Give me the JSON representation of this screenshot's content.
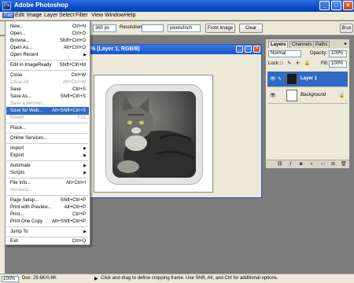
{
  "window": {
    "title": "Adobe Photoshop",
    "app_icon": "Ps"
  },
  "menubar": [
    "File",
    "Edit",
    "Image",
    "Layer",
    "Select",
    "Filter",
    "View",
    "Window",
    "Help"
  ],
  "options": {
    "height_value": "360 px",
    "resolution_label": "Resolution:",
    "resolution_value": "",
    "resolution_unit": "pixels/inch",
    "front_image": "Front Image",
    "clear": "Clear",
    "brushes": "Brus"
  },
  "document": {
    "title": "% (Layer 1, RGB/8)"
  },
  "file_menu": [
    {
      "label": "New...",
      "shortcut": "Ctrl+N"
    },
    {
      "label": "Open...",
      "shortcut": "Ctrl+O"
    },
    {
      "label": "Browse...",
      "shortcut": "Shift+Ctrl+O"
    },
    {
      "label": "Open As...",
      "shortcut": "Alt+Ctrl+O"
    },
    {
      "label": "Open Recent",
      "shortcut": "",
      "submenu": true
    },
    {
      "label": "Edit in ImageReady",
      "shortcut": "Shift+Ctrl+M"
    },
    {
      "label": "Close",
      "shortcut": "Ctrl+W"
    },
    {
      "label": "Close All",
      "shortcut": "Alt+Ctrl+W",
      "disabled": true
    },
    {
      "label": "Save",
      "shortcut": "Ctrl+S"
    },
    {
      "label": "Save As...",
      "shortcut": "Shift+Ctrl+S"
    },
    {
      "label": "Save a Version...",
      "shortcut": "",
      "disabled": true
    },
    {
      "label": "Save for Web...",
      "shortcut": "Alt+Shift+Ctrl+S",
      "highlight": true
    },
    {
      "label": "Revert",
      "shortcut": "F12",
      "disabled": true
    },
    {
      "label": "Place...",
      "shortcut": ""
    },
    {
      "label": "Online Services...",
      "shortcut": ""
    },
    {
      "label": "Import",
      "shortcut": "",
      "submenu": true
    },
    {
      "label": "Export",
      "shortcut": "",
      "submenu": true
    },
    {
      "label": "Automate",
      "shortcut": "",
      "submenu": true
    },
    {
      "label": "Scripts",
      "shortcut": "",
      "submenu": true
    },
    {
      "label": "File Info...",
      "shortcut": "Alt+Ctrl+I"
    },
    {
      "label": "Versions...",
      "shortcut": "",
      "disabled": true
    },
    {
      "label": "Page Setup...",
      "shortcut": "Shift+Ctrl+P"
    },
    {
      "label": "Print with Preview...",
      "shortcut": "Alt+Ctrl+P"
    },
    {
      "label": "Print...",
      "shortcut": "Ctrl+P"
    },
    {
      "label": "Print One Copy",
      "shortcut": "Alt+Shift+Ctrl+P"
    },
    {
      "label": "Jump To",
      "shortcut": "",
      "submenu": true
    },
    {
      "label": "Exit",
      "shortcut": "Ctrl+Q"
    }
  ],
  "layers_panel": {
    "tabs": [
      "Layers",
      "Channels",
      "Paths"
    ],
    "blend_mode": "Normal",
    "opacity_label": "Opacity:",
    "opacity_value": "100%",
    "lock_label": "Lock:",
    "fill_label": "Fill:",
    "fill_value": "100%",
    "layers": [
      {
        "name": "Layer 1",
        "selected": true
      },
      {
        "name": "Background",
        "selected": false
      }
    ]
  },
  "status": {
    "zoom": "100%",
    "doc": "Doc: 29.6K/0.6K",
    "hint": "Click and drag to define cropping frame. Use Shift, Alt, and Ctrl for additional options."
  }
}
